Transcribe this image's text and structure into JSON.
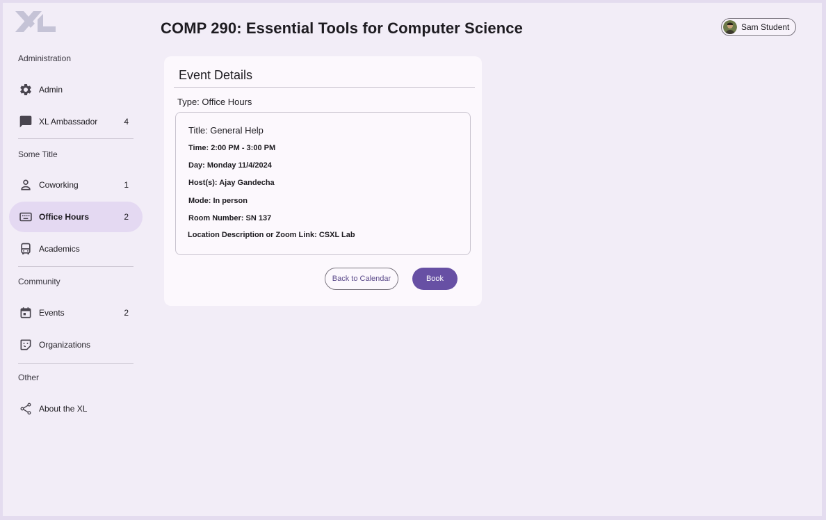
{
  "app": {
    "logo_alt": "XL"
  },
  "sidebar": {
    "sections": [
      {
        "title": "Administration"
      },
      {
        "title": "Some Title"
      },
      {
        "title": "Community"
      },
      {
        "title": "Other"
      }
    ],
    "items": [
      {
        "label": "Admin",
        "badge": "",
        "icon": "gear-icon"
      },
      {
        "label": "XL Ambassador",
        "badge": "4",
        "icon": "chat-icon"
      },
      {
        "label": "Coworking",
        "badge": "1",
        "icon": "person-icon"
      },
      {
        "label": "Office Hours",
        "badge": "2",
        "icon": "keyboard-icon",
        "active": true
      },
      {
        "label": "Academics",
        "badge": "",
        "icon": "bus-icon"
      },
      {
        "label": "Events",
        "badge": "2",
        "icon": "calendar-icon"
      },
      {
        "label": "Organizations",
        "badge": "",
        "icon": "sticker-icon"
      },
      {
        "label": "About the XL",
        "badge": "",
        "icon": "share-icon"
      }
    ]
  },
  "header": {
    "title": "COMP 290: Essential Tools for Computer Science",
    "user_name": "Sam Student"
  },
  "event": {
    "card_title": "Event Details",
    "type": "Type: Office Hours",
    "title": "Title: General Help",
    "time": "Time: 2:00 PM - 3:00 PM",
    "day": "Day: Monday 11/4/2024",
    "hosts": "Host(s): Ajay Gandecha",
    "mode": "Mode: In person",
    "room": "Room Number: SN 137",
    "location": "Location Description or Zoom Link: CSXL Lab"
  },
  "actions": {
    "back_label": "Back to Calendar",
    "book_label": "Book"
  },
  "colors": {
    "primary": "#6750a4",
    "active_nav": "#e4d9f2",
    "background": "#f2edf7"
  }
}
